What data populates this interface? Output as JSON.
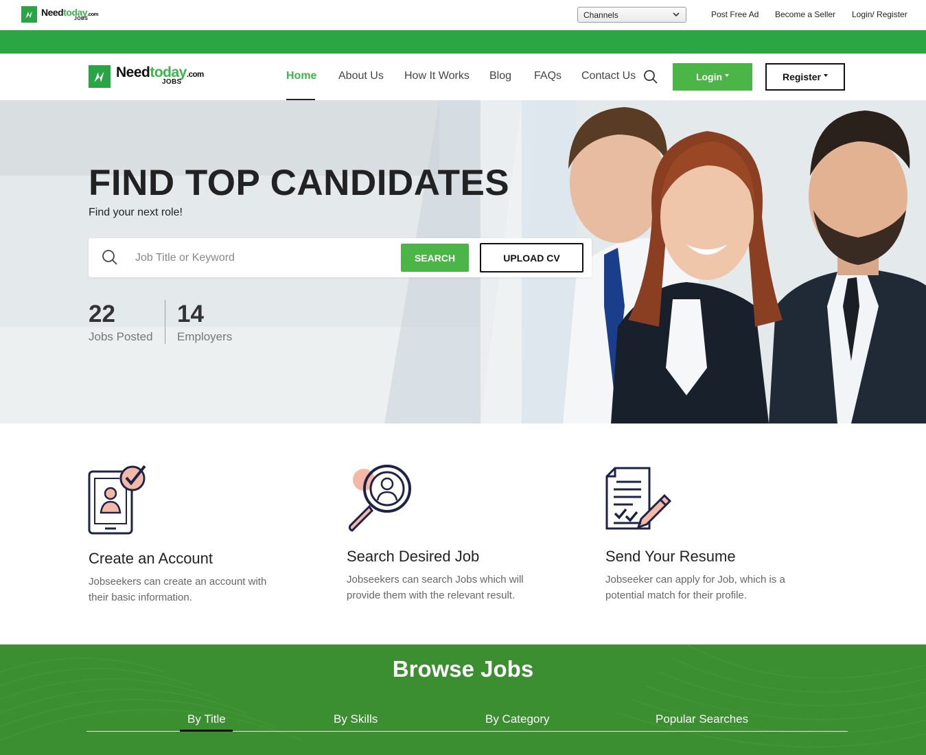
{
  "brand": {
    "name_part1": "Need",
    "name_part2": "today",
    "name_suffix": ".com",
    "name_sub": "JOBS",
    "green": "#3cb54a",
    "dark_green": "#3b8f30"
  },
  "topbar": {
    "channels_select": "Channels",
    "links": [
      "Post Free Ad",
      "Become a Seller",
      "Login/ Register"
    ]
  },
  "nav": {
    "items": [
      "Home",
      "About Us",
      "How It Works",
      "Blog",
      "FAQs",
      "Contact Us"
    ],
    "active": "Home",
    "login_label": "Login",
    "register_label": "Register"
  },
  "hero": {
    "title": "FIND TOP CANDIDATES",
    "subtitle": "Find your next role!",
    "search_placeholder": "Job Title or Keyword",
    "search_button": "SEARCH",
    "upload_button": "UPLOAD CV",
    "stats": [
      {
        "value": "22",
        "label": "Jobs Posted"
      },
      {
        "value": "14",
        "label": "Employers"
      }
    ]
  },
  "features": [
    {
      "icon": "account-profile-icon",
      "title": "Create an Account",
      "desc_line1": "Jobseekers can create an account with",
      "desc_line2": "their basic information."
    },
    {
      "icon": "search-profile-icon",
      "title": "Search Desired Job",
      "desc_line1": "Jobseekers can search Jobs which will",
      "desc_line2": "provide them with the relevant result."
    },
    {
      "icon": "resume-document-icon",
      "title": "Send Your Resume",
      "desc_line1": "Jobseeker can apply for Job, which is a",
      "desc_line2": "potential match for their profile."
    }
  ],
  "browse": {
    "title": "Browse Jobs",
    "tabs": [
      "By Title",
      "By Skills",
      "By Category",
      "Popular Searches"
    ],
    "active_tab": "By Title"
  }
}
